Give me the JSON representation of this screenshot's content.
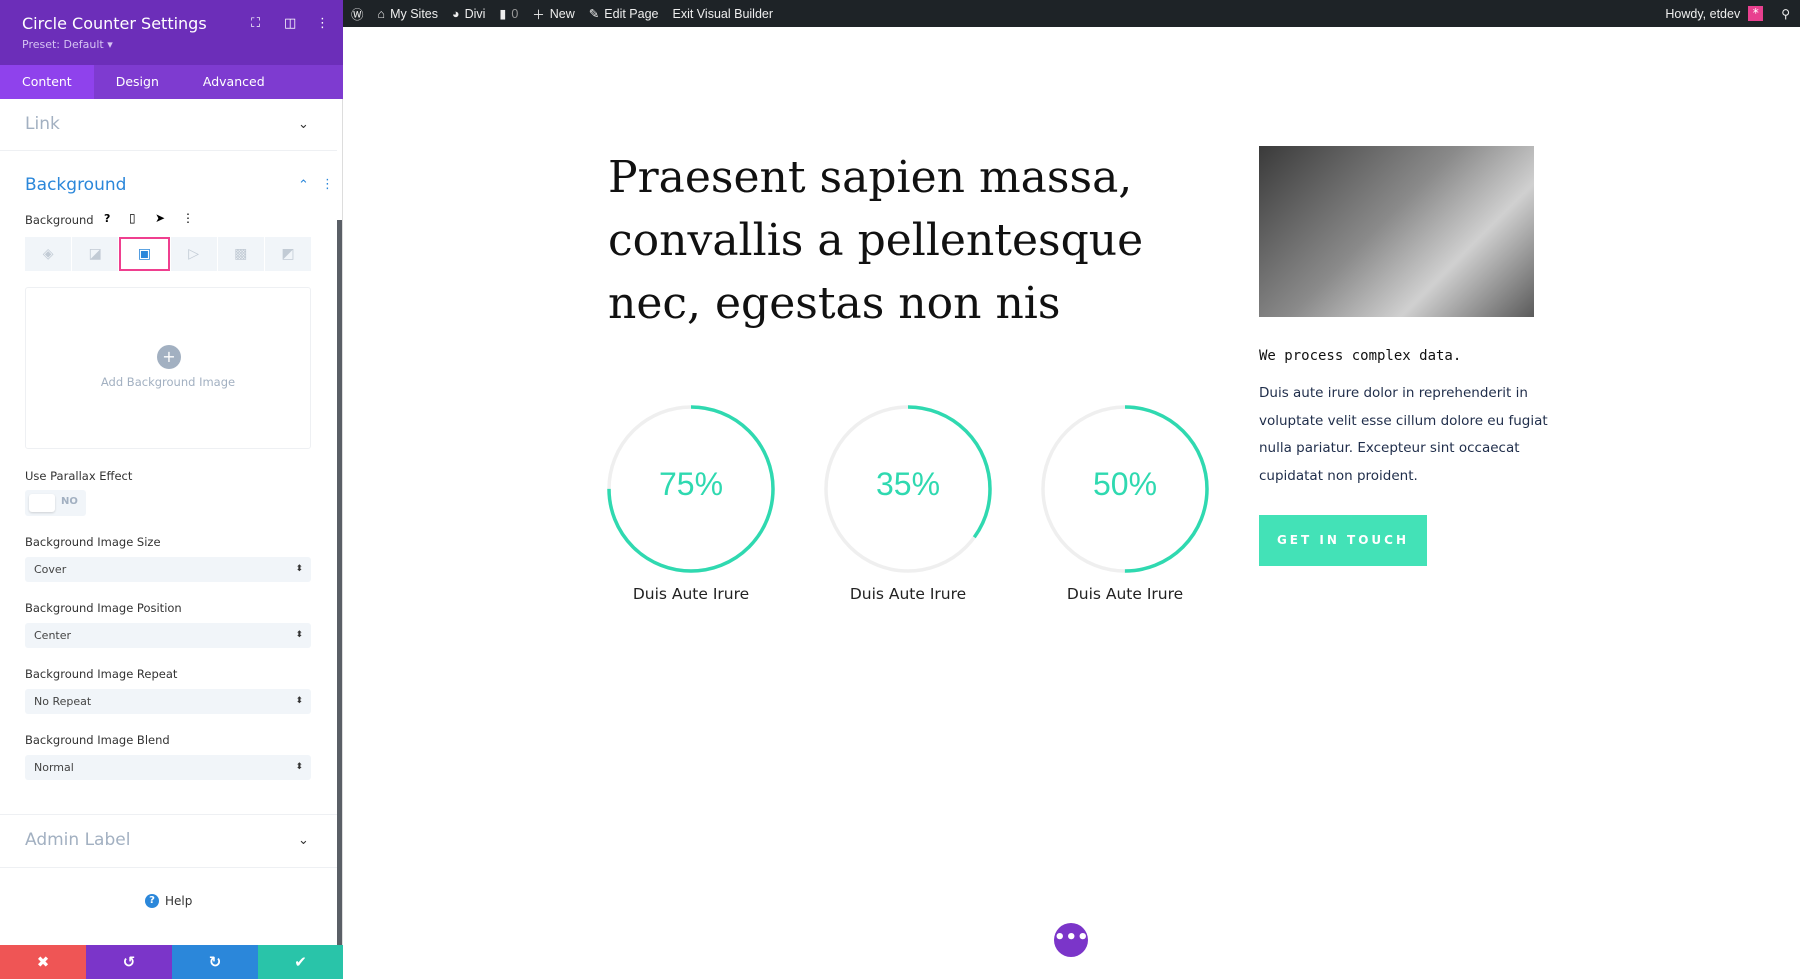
{
  "adminbar": {
    "items": [
      "My Sites",
      "Divi",
      "0",
      "New",
      "Edit Page",
      "Exit Visual Builder"
    ],
    "howdy": "Howdy, etdev"
  },
  "panel": {
    "title": "Circle Counter Settings",
    "preset": "Preset: Default ▾",
    "tabs": [
      "Content",
      "Design",
      "Advanced"
    ],
    "link_section": "Link",
    "background_section": "Background",
    "background_label": "Background",
    "add_image": "Add Background Image",
    "parallax_label": "Use Parallax Effect",
    "parallax_value": "NO",
    "fields": [
      {
        "label": "Background Image Size",
        "value": "Cover"
      },
      {
        "label": "Background Image Position",
        "value": "Center"
      },
      {
        "label": "Background Image Repeat",
        "value": "No Repeat"
      },
      {
        "label": "Background Image Blend",
        "value": "Normal"
      }
    ],
    "admin_label_section": "Admin Label",
    "help": "Help"
  },
  "colors": {
    "purple": "#6c2eb9",
    "accent": "#2fd9b0",
    "cancel": "#ef5555",
    "undo": "#7b35c9",
    "redo": "#2b87da",
    "save": "#29c4a9"
  },
  "main": {
    "heading": "Praesent sapien massa, convallis a pellentesque nec, egestas non nis",
    "tagline": "We process complex data.",
    "paragraph": "Duis aute irure dolor in reprehenderit in voluptate velit esse cillum dolore eu fugiat nulla pariatur. Excepteur sint occaecat cupidatat non proident.",
    "cta": "GET IN TOUCH",
    "counters": [
      {
        "percent": 75,
        "text": "75%",
        "label": "Duis Aute Irure"
      },
      {
        "percent": 35,
        "text": "35%",
        "label": "Duis Aute Irure"
      },
      {
        "percent": 50,
        "text": "50%",
        "label": "Duis Aute Irure"
      }
    ]
  }
}
